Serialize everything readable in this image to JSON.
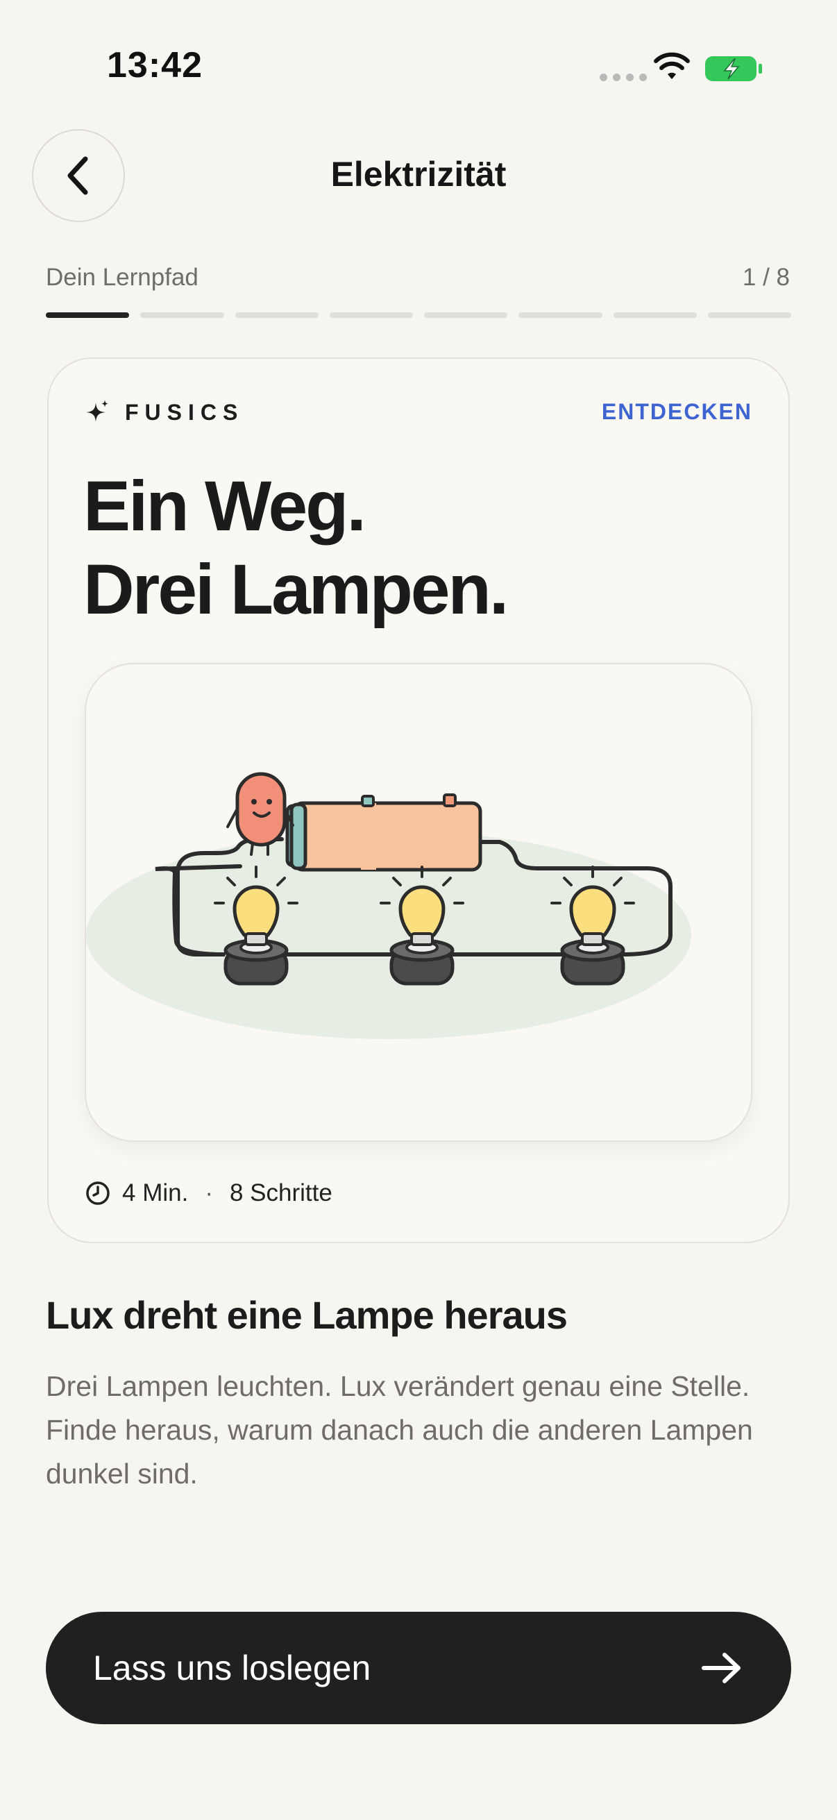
{
  "status_bar": {
    "time": "13:42",
    "icons": [
      "signal-dots-icon",
      "wifi-icon",
      "battery-charging-icon"
    ],
    "battery_color": "#34c759"
  },
  "header": {
    "back_icon": "chevron-left-icon",
    "title": "Elektrizität"
  },
  "progress": {
    "label": "Dein Lernpfad",
    "counter": "1 / 8",
    "current_step": 1,
    "total_steps": 8
  },
  "card": {
    "brand_icon": "sparkle-icon",
    "brand": "FUSICS",
    "discover_link": "ENTDECKEN",
    "title_line_1": "Ein Weg.",
    "title_line_2": "Drei Lampen.",
    "illustration": "circuit-with-battery-three-lamps-and-character",
    "duration_icon": "clock-icon",
    "duration": "4 Min.",
    "separator": "·",
    "steps": "8 Schritte"
  },
  "lesson": {
    "heading": "Lux dreht eine Lampe heraus",
    "description": "Drei Lampen leuchten. Lux verändert genau eine Stelle. Finde heraus, warum danach auch die anderen Lampen dunkel sind."
  },
  "cta": {
    "label": "Lass uns loslegen",
    "icon": "arrow-right-icon"
  },
  "colors": {
    "background": "#f7f5f0",
    "accent_link": "#3e64d1",
    "cta_background": "#202020"
  }
}
